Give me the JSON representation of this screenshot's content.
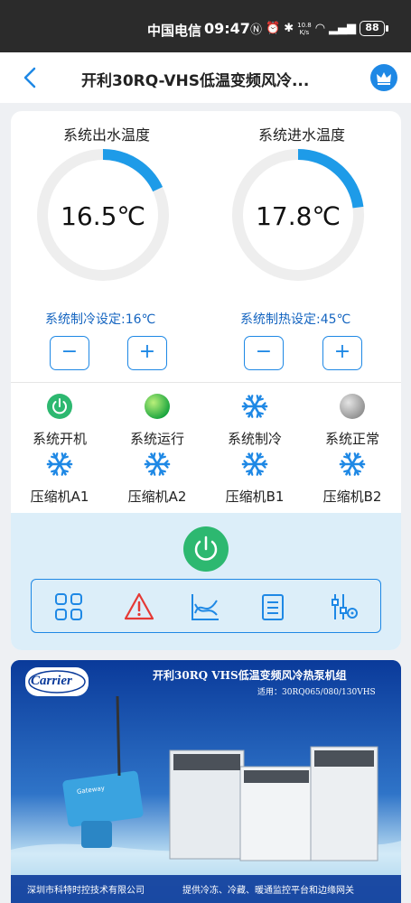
{
  "status_bar": {
    "carrier": "中国电信",
    "time": "09:47",
    "net_speed": "10.8",
    "net_unit": "K/s",
    "battery": "88"
  },
  "header": {
    "title": "开利30RQ-VHS低温变频风冷..."
  },
  "gauges": [
    {
      "label": "系统出水温度",
      "value": "16.5℃",
      "fill_fraction": 0.18,
      "setpoint": "系统制冷设定:16℃"
    },
    {
      "label": "系统进水温度",
      "value": "17.8℃",
      "fill_fraction": 0.23,
      "setpoint": "系统制热设定:45℃"
    }
  ],
  "buttons": {
    "minus": "−",
    "plus": "+"
  },
  "status_items": [
    {
      "label": "系统开机",
      "icon": "power-green-icon"
    },
    {
      "label": "系统运行",
      "icon": "green-dot-icon"
    },
    {
      "label": "系统制冷",
      "icon": "snowflake-icon"
    },
    {
      "label": "系统正常",
      "icon": "gray-dot-icon"
    },
    {
      "label": "压缩机A1",
      "icon": "snowflake-icon"
    },
    {
      "label": "压缩机A2",
      "icon": "snowflake-icon"
    },
    {
      "label": "压缩机B1",
      "icon": "snowflake-icon"
    },
    {
      "label": "压缩机B2",
      "icon": "snowflake-icon"
    }
  ],
  "toolbar": [
    "grid-icon",
    "alarm-warning-icon",
    "trend-chart-icon",
    "list-document-icon",
    "settings-sliders-icon"
  ],
  "banner": {
    "brand": "Carrier",
    "headline": "开利30RQ VHS低温变频风冷热泵机组",
    "applies_to": "适用：30RQ065/080/130VHS",
    "footer_left": "深圳市科特时控技术有限公司",
    "footer_right": "提供冷冻、冷藏、暖通监控平台和边缘网关",
    "device_label": "Gateway"
  },
  "colors": {
    "accent": "#1e88e5",
    "gauge_track": "#eeeeee",
    "power_green": "#2db870",
    "banner_blue": "#0d3f9e"
  }
}
